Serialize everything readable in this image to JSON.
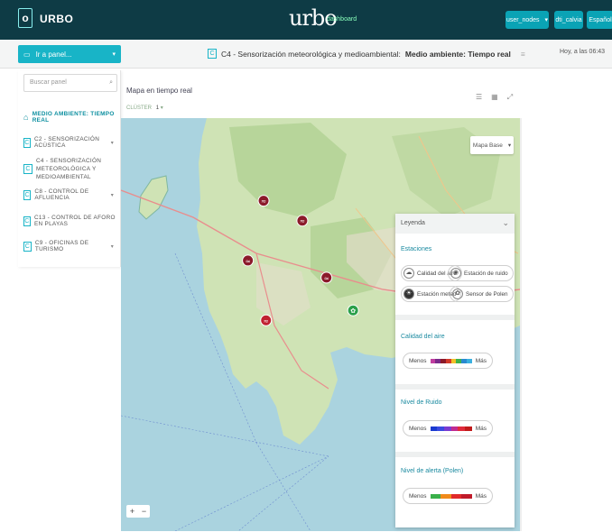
{
  "topbar": {
    "logo": "o",
    "app_title": "URBO",
    "brand": "urbo",
    "brand_sub": "dashboard",
    "user": "user_nodes",
    "config": "dti_calvia",
    "lang": "Español"
  },
  "subbar": {
    "goto_label": "Ir a panel...",
    "panel_code": "C",
    "panel_prefix": "C4 - Sensorización meteorológica y medioambiental:",
    "panel_name": "Medio ambiente: Tiempo real",
    "updated": "Hoy, a las 06:43"
  },
  "sidebar": {
    "search_placeholder": "Buscar panel",
    "items": [
      {
        "label": "MEDIO AMBIENTE: TIEMPO REAL"
      },
      {
        "code": "C",
        "label": "C2 - SENSORIZACIÓN ACÚSTICA"
      },
      {
        "code": "C",
        "label": "C4 - SENSORIZACIÓN METEOROLÓGICA Y MEDIOAMBIENTAL"
      },
      {
        "code": "C",
        "label": "C8 - CONTROL DE AFLUENCIA"
      },
      {
        "code": "C",
        "label": "C13 - CONTROL DE AFORO EN PLAYAS"
      },
      {
        "code": "C",
        "label": "C9 - OFICINAS DE TURISMO"
      }
    ]
  },
  "map": {
    "title": "Mapa en tiempo real",
    "cluster": "CLÚSTER",
    "cluster_value": "1",
    "basemap": "Mapa Base",
    "zoom_in": "+",
    "zoom_out": "−"
  },
  "legend": {
    "title": "Leyenda",
    "stations_title": "Estaciones",
    "stations": [
      "Calidad del aire",
      "Estación de ruido",
      "Estación meteo",
      "Sensor de Polen"
    ],
    "air": {
      "title": "Calidad del aire",
      "min": "Menos",
      "max": "Más",
      "colors": [
        "#c03fa0",
        "#7a2a8a",
        "#8b1a2a",
        "#d23a2a",
        "#f2c02a",
        "#3fb24a",
        "#2a8ad0",
        "#3ab0e0"
      ]
    },
    "noise": {
      "title": "Nivel de Ruido",
      "min": "Menos",
      "max": "Más",
      "colors": [
        "#1a3ad0",
        "#3a4ae0",
        "#7a3ad0",
        "#c02a90",
        "#e02a3a",
        "#c01a1a"
      ]
    },
    "pollen": {
      "title": "Nivel de alerta (Polen)",
      "min": "Menos",
      "max": "Más",
      "colors": [
        "#3ab04a",
        "#f08a1a",
        "#e02a2a",
        "#c01a2a"
      ]
    }
  },
  "map_markers": [
    {
      "type": "air",
      "color": "#8b1a2a",
      "lon": 2.448,
      "lat": 39.572
    },
    {
      "type": "air",
      "color": "#8b1a2a",
      "lon": 2.48,
      "lat": 39.558
    },
    {
      "type": "air",
      "color": "#8b1a2a",
      "lon": 2.435,
      "lat": 39.53
    },
    {
      "type": "air",
      "color": "#8b1a2a",
      "lon": 2.5,
      "lat": 39.518
    },
    {
      "type": "air",
      "color": "#c02030",
      "lon": 2.45,
      "lat": 39.488
    },
    {
      "type": "pollen",
      "color": "#2aa04a",
      "lon": 2.522,
      "lat": 39.495
    },
    {
      "type": "meteo",
      "color": "#2aa0d0",
      "lon": 2.583,
      "lat": 39.532
    }
  ]
}
